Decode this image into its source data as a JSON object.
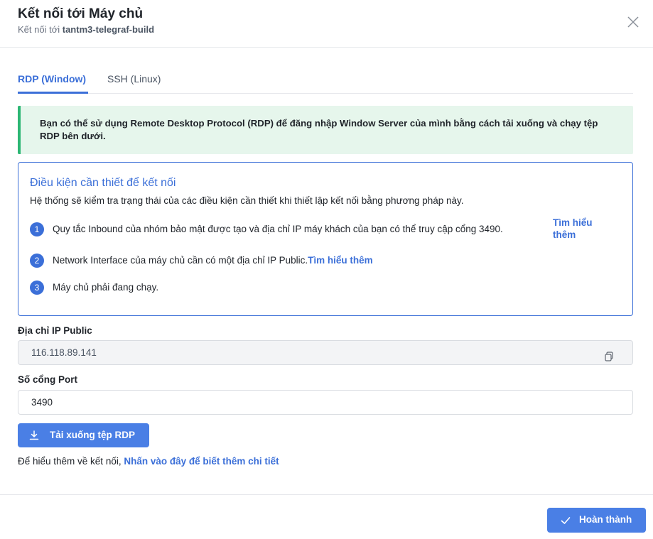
{
  "dialog": {
    "title": "Kết nối tới Máy chủ",
    "subtitle_prefix": "Kết nối tới",
    "server_name": "tantm3-telegraf-build"
  },
  "tabs": [
    {
      "label": "RDP (Window)",
      "active": true
    },
    {
      "label": "SSH (Linux)",
      "active": false
    }
  ],
  "alert": {
    "text": "Bạn có thể sử dụng Remote Desktop Protocol (RDP) để đăng nhập Window Server của mình bằng cách tải xuống và chạy tệp RDP bên dưới."
  },
  "requirements": {
    "title": "Điều kiện cần thiết để kết nối",
    "description": "Hệ thống sẽ kiểm tra trạng thái của các điều kiện cần thiết khi thiết lập kết nối bằng phương pháp này.",
    "items": [
      {
        "number": "1",
        "text": "Quy tắc Inbound của nhóm bảo mật được tạo và địa chỉ IP máy khách của bạn có thể truy cập cổng 3490.",
        "link": "Tìm hiểu thêm"
      },
      {
        "number": "2",
        "text": "Network Interface của máy chủ cần có một địa chỉ IP Public.",
        "link": "Tìm hiểu thêm"
      },
      {
        "number": "3",
        "text": "Máy chủ phải đang chạy."
      }
    ]
  },
  "fields": {
    "ip_label": "Địa chỉ IP Public",
    "ip_value": "116.118.89.141",
    "port_label": "Số cổng Port",
    "port_value": "3490"
  },
  "download_button": "Tải xuống tệp RDP",
  "more_info": {
    "prefix": "Để hiểu thêm về kết nối,",
    "link": "Nhấn vào đây để biết thêm chi tiết"
  },
  "done_button": "Hoàn thành",
  "colors": {
    "accent": "#3b6fd8",
    "button": "#4a7fe5",
    "alert_bg": "#e6f6ec",
    "alert_border": "#2bb673"
  },
  "icons": [
    "close-icon",
    "copy-icon",
    "download-icon",
    "check-icon"
  ]
}
